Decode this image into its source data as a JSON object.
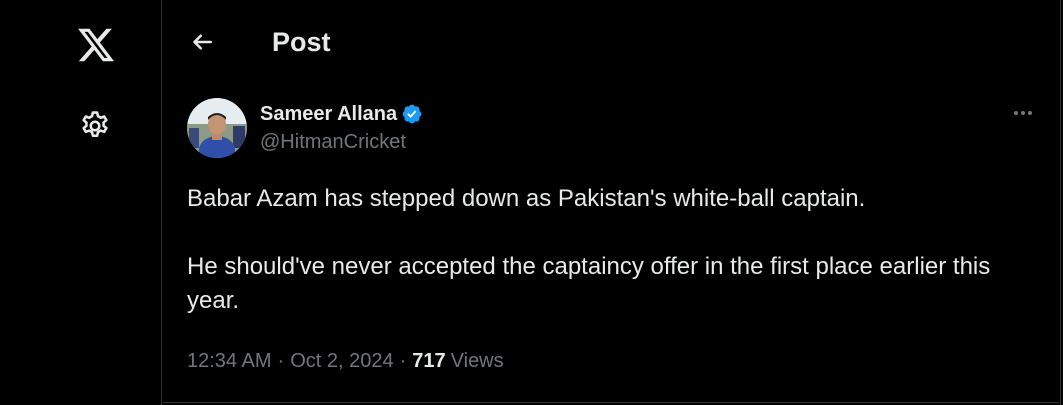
{
  "header": {
    "title": "Post"
  },
  "post": {
    "author": {
      "display_name": "Sameer Allana",
      "handle": "@HitmanCricket",
      "verified": true
    },
    "text_paragraphs": [
      "Babar Azam has stepped down as Pakistan's white-ball captain.",
      "He should've never accepted the captaincy offer in the first place earlier this year."
    ],
    "meta": {
      "time": "12:34 AM",
      "separator": "·",
      "date": "Oct 2, 2024",
      "views_count": "717",
      "views_label": "Views"
    }
  },
  "icons": {
    "logo": "x-logo-icon",
    "settings": "gear-icon",
    "back": "arrow-left-icon",
    "verified": "verified-badge-icon",
    "more": "more-horizontal-icon"
  },
  "colors": {
    "background": "#000000",
    "text_primary": "#e7e9ea",
    "text_secondary": "#71767b",
    "border": "#2f3336",
    "verified_blue": "#1d9bf0"
  }
}
